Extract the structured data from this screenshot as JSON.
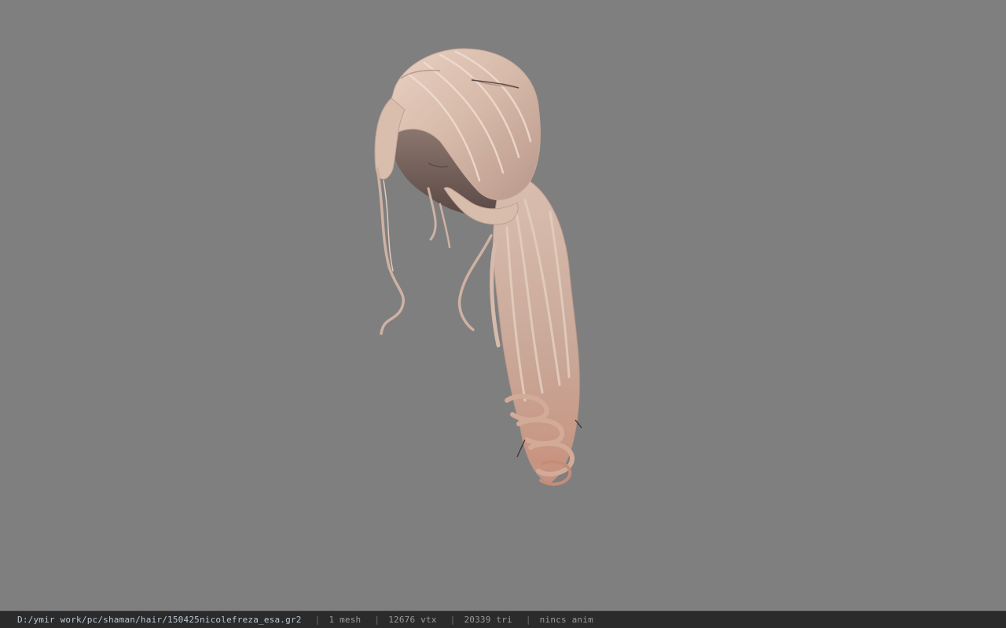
{
  "viewport": {
    "background": "#7f7f7f",
    "model": "hair-mesh"
  },
  "statusbar": {
    "path": "D:/ymir work/pc/shaman/hair/150425nicolefreza_esa.gr2",
    "separator": "|",
    "mesh_count": "1 mesh",
    "vertex_count": "12676 vtx",
    "triangle_count": "20339 tri",
    "anim": "nincs anim"
  }
}
